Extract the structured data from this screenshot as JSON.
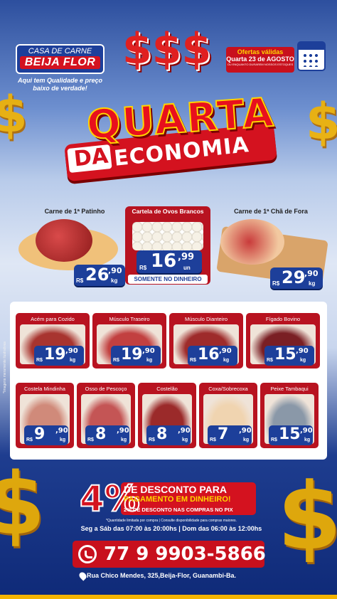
{
  "brand": {
    "line1": "CASA DE CARNE",
    "line2": "BEIJA FLOR",
    "slogan": "Aqui tem Qualidade e preço baixo de verdade!"
  },
  "offer": {
    "title": "Ofertas válidas",
    "date": "Quarta 23 de AGOSTO",
    "small": "OU ENQUANTO DURAREM NOSSOS ESTOQUES"
  },
  "headline": {
    "dollars": "$$$",
    "quarta": "QUARTA",
    "da": "DA",
    "economia": "ECONOMIA"
  },
  "featured": [
    {
      "name": "Carne de 1ª Patinho",
      "currency": "R$",
      "int": "26",
      "dec": ",90",
      "unit": "kg"
    },
    {
      "name": "Cartela de Ovos Brancos",
      "currency": "R$",
      "int": "16",
      "dec": ",99",
      "unit": "un",
      "note": "SOMENTE NO DINHEIRO"
    },
    {
      "name": "Carne de 1ª Chã de Fora",
      "currency": "R$",
      "int": "29",
      "dec": ",90",
      "unit": "kg"
    }
  ],
  "products": [
    {
      "name": "Acém para Cozido",
      "currency": "R$",
      "int": "19",
      "dec": ",90",
      "unit": "kg"
    },
    {
      "name": "Músculo Traseiro",
      "currency": "R$",
      "int": "19",
      "dec": ",90",
      "unit": "kg"
    },
    {
      "name": "Músculo Dianteiro",
      "currency": "R$",
      "int": "16",
      "dec": ",90",
      "unit": "kg"
    },
    {
      "name": "Fígado Bovino",
      "currency": "R$",
      "int": "15",
      "dec": ",90",
      "unit": "kg"
    },
    {
      "name": "Costela Mindinha",
      "currency": "R$",
      "int": "9",
      "dec": ",90",
      "unit": "kg"
    },
    {
      "name": "Osso de Pescoço",
      "currency": "R$",
      "int": "8",
      "dec": ",90",
      "unit": "kg"
    },
    {
      "name": "Costelão",
      "currency": "R$",
      "int": "8",
      "dec": ",90",
      "unit": "kg"
    },
    {
      "name": "Coxa/Sobrecoxa",
      "currency": "R$",
      "int": "7",
      "dec": ",90",
      "unit": "kg"
    },
    {
      "name": "Peixe Tambaqui",
      "currency": "R$",
      "int": "15",
      "dec": ",90",
      "unit": "kg"
    }
  ],
  "side_note": "*Imagens meramente ilustrativas",
  "discount": {
    "percent": "4%",
    "line1": "DE DESCONTO PARA",
    "line2": "PAGAMENTO EM DINHEIRO!",
    "line3": "2% DE DESCONTO NAS COMPRAS NO PIX"
  },
  "notes": "*Quantidade limitada por compra | Consulte disponibilidade para compras maiores.",
  "hours": "Seg a Sáb das 07:00 às 20:00hs | Dom das 06:00 às 12:00hs",
  "phone": "77 9 9903-5866",
  "address": "Rua Chico Mendes, 325,Beija-Flor, Guanambi-Ba.",
  "colors": {
    "red": "#d4121f",
    "blue": "#1d3f9a",
    "yellow": "#f4b400"
  }
}
